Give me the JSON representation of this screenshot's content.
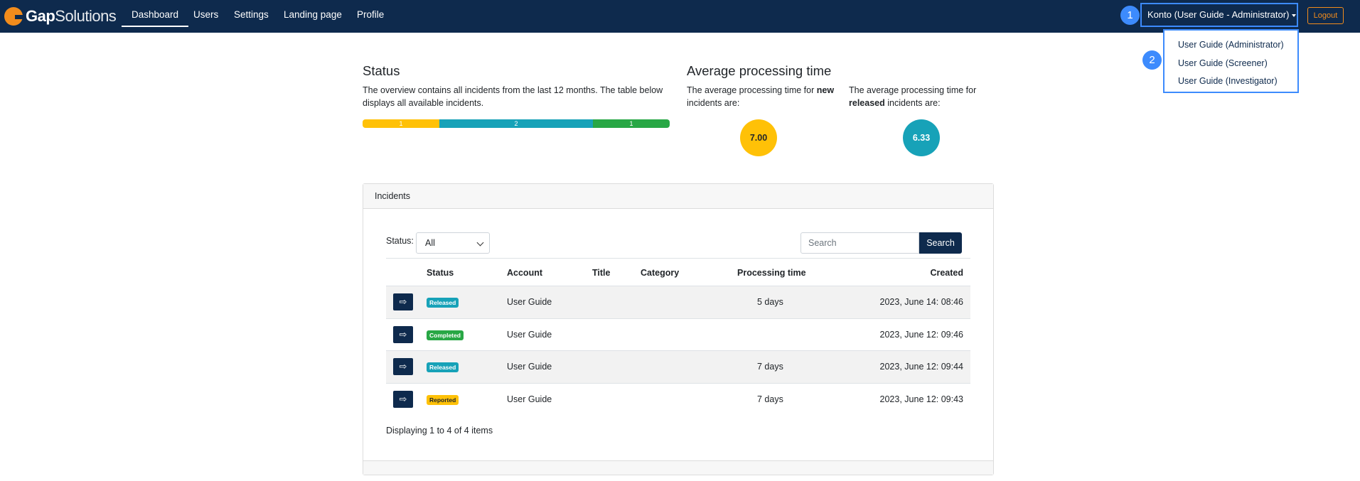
{
  "brand": {
    "part1": "Gap",
    "part2": "Solutions"
  },
  "nav": {
    "items": [
      {
        "label": "Dashboard",
        "active": true
      },
      {
        "label": "Users"
      },
      {
        "label": "Settings"
      },
      {
        "label": "Landing page"
      },
      {
        "label": "Profile"
      }
    ],
    "account_label": "Konto (User Guide - Administrator)",
    "logout_label": "Logout"
  },
  "annotations": {
    "step1": "1",
    "step2": "2",
    "color": "#3d8bfd"
  },
  "account_menu": {
    "items": [
      "User Guide (Administrator)",
      "User Guide (Screener)",
      "User Guide (Investigator)"
    ]
  },
  "status": {
    "title": "Status",
    "description": "The overview contains all incidents from the last 12 months. The table below displays all available incidents.",
    "bar": [
      {
        "label": "1",
        "value": 1,
        "color": "#ffc107"
      },
      {
        "label": "2",
        "value": 2,
        "color": "#17a2b8"
      },
      {
        "label": "1",
        "value": 1,
        "color": "#28a745"
      }
    ]
  },
  "avg": {
    "title": "Average processing time",
    "new_prefix": "The average processing time for",
    "new_bold": "new",
    "new_suffix": "incidents are:",
    "new_value": "7.00",
    "released_prefix": "The average processing time for",
    "released_bold": "released",
    "released_suffix": "incidents are:",
    "released_value": "6.33"
  },
  "incidents": {
    "header": "Incidents",
    "filter_label": "Status:",
    "filter_value": "All",
    "search_placeholder": "Search",
    "search_button": "Search",
    "columns": [
      "Status",
      "Account",
      "Title",
      "Category",
      "Processing time",
      "Created"
    ],
    "rows": [
      {
        "status": "Released",
        "status_color": "#17a2b8",
        "account": "User Guide",
        "title": "",
        "category": "",
        "processing": "5 days",
        "created": "2023, June 14: 08:46"
      },
      {
        "status": "Completed",
        "status_color": "#28a745",
        "account": "User Guide",
        "title": "",
        "category": "",
        "processing": "",
        "created": "2023, June 12: 09:46"
      },
      {
        "status": "Released",
        "status_color": "#17a2b8",
        "account": "User Guide",
        "title": "",
        "category": "",
        "processing": "7 days",
        "created": "2023, June 12: 09:44"
      },
      {
        "status": "Reported",
        "status_color": "#ffc107",
        "account": "User Guide",
        "title": "",
        "category": "",
        "processing": "7 days",
        "created": "2023, June 12: 09:43"
      }
    ],
    "row_button_icon": "⇨",
    "info": "Displaying 1 to 4 of 4 items"
  }
}
